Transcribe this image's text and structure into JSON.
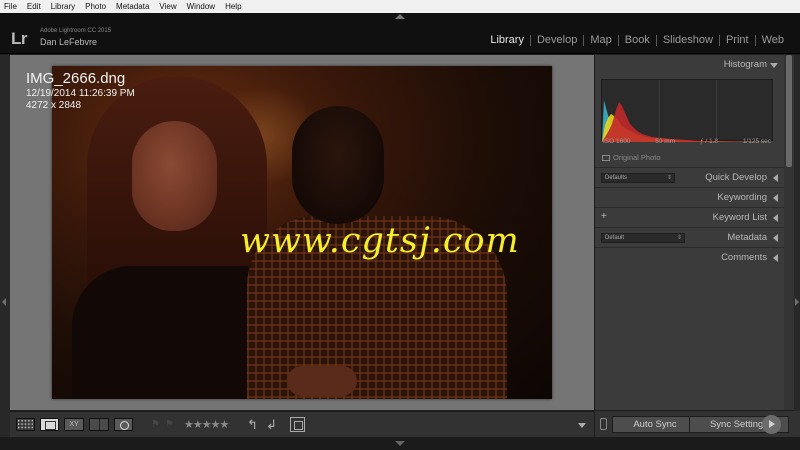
{
  "menu": [
    "File",
    "Edit",
    "Library",
    "Photo",
    "Metadata",
    "View",
    "Window",
    "Help"
  ],
  "identity": {
    "logo": "Lr",
    "app_name": "Adobe Lightroom CC 2015",
    "user_name": "Dan LeFebvre"
  },
  "modules": [
    "Library",
    "Develop",
    "Map",
    "Book",
    "Slideshow",
    "Print",
    "Web"
  ],
  "active_module": "Library",
  "photo_info": {
    "filename": "IMG_2666.dng",
    "datetime": "12/19/2014 11:26:39 PM",
    "dimensions": "4272 x 2848"
  },
  "watermark": "www.cgtsj.com",
  "toolbar": {
    "compare_label": "XY",
    "stars": "★★★★★",
    "rotate_left": "↰",
    "rotate_right": "↲",
    "flag_pick": "⚑",
    "flag_reject": "⚑"
  },
  "panels": {
    "histogram": {
      "title": "Histogram",
      "iso": "ISO 1600",
      "focal": "50 mm",
      "aperture": "ƒ / 1.8",
      "shutter": "1/125 sec",
      "original_photo": "Original Photo"
    },
    "quick_develop": {
      "title": "Quick Develop",
      "preset": "Defaults"
    },
    "keywording": {
      "title": "Keywording"
    },
    "keyword_list": {
      "title": "Keyword List",
      "add": "+"
    },
    "metadata": {
      "title": "Metadata",
      "preset": "Default"
    },
    "comments": {
      "title": "Comments"
    }
  },
  "sync": {
    "auto_sync": "Auto Sync",
    "sync_settings": "Sync Settings"
  },
  "colors": {
    "histogram_red": "#c0282a",
    "histogram_yellow": "#e6d51e",
    "histogram_cyan": "#39b7c9",
    "watermark": "#f6ee28"
  }
}
